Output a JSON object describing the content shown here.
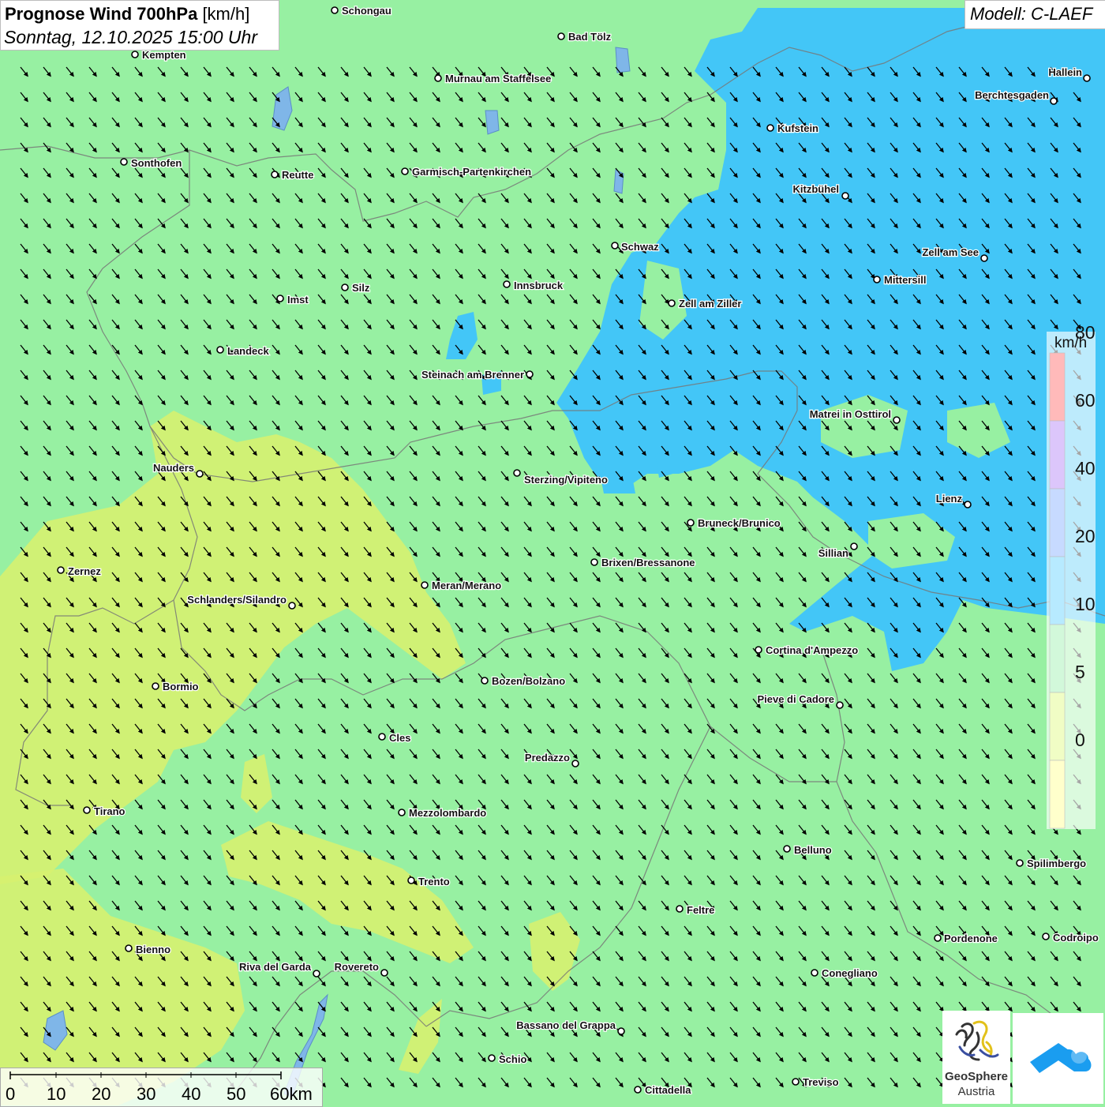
{
  "title": {
    "bold": "Prognose Wind 700hPa",
    "unit": "[km/h]",
    "datetime": "Sonntag, 12.10.2025 15:00 Uhr"
  },
  "model": "Modell: C-LAEF",
  "legend": {
    "unit": "km/h",
    "ticks": [
      "80",
      "60",
      "40",
      "20",
      "10",
      "5",
      "0"
    ],
    "colors": [
      "#ff3a3a",
      "#9b5cf2",
      "#5e95ff",
      "#33c3ff",
      "#7eea96",
      "#d4fa5a",
      "#ffff6e"
    ]
  },
  "scalebar": {
    "labels": [
      "0",
      "10",
      "20",
      "30",
      "40",
      "50",
      "60km"
    ]
  },
  "logos": {
    "geosphere_name": "GeoSphere",
    "geosphere_country": "Austria",
    "geosphere_icon": "geosphere-logo-icon",
    "app_icon": "cloud-arrow-app-icon"
  },
  "colors": {
    "background_wind": "#97f0a2",
    "strong_wind": "#43c6f7",
    "weak_wind": "#d6f170",
    "arrow": "#000000"
  },
  "wind_direction": "northwest to southeast",
  "cities": [
    {
      "name": "Schongau"
    },
    {
      "name": "Bad Tölz"
    },
    {
      "name": "Kempten"
    },
    {
      "name": "Murnau am Staffelsee"
    },
    {
      "name": "Hallein"
    },
    {
      "name": "Berchtesgaden"
    },
    {
      "name": "Kufstein"
    },
    {
      "name": "Sonthofen"
    },
    {
      "name": "Reutte"
    },
    {
      "name": "Garmisch-Partenkirchen"
    },
    {
      "name": "Kitzbühel"
    },
    {
      "name": "Schwaz"
    },
    {
      "name": "Zell am See"
    },
    {
      "name": "Mittersill"
    },
    {
      "name": "Innsbruck"
    },
    {
      "name": "Silz"
    },
    {
      "name": "Imst"
    },
    {
      "name": "Zell am Ziller"
    },
    {
      "name": "Landeck"
    },
    {
      "name": "Steinach am Brenner"
    },
    {
      "name": "Matrei in Osttirol"
    },
    {
      "name": "Nauders"
    },
    {
      "name": "Sterzing/Vipiteno"
    },
    {
      "name": "Lienz"
    },
    {
      "name": "Bruneck/Brunico"
    },
    {
      "name": "Sillian"
    },
    {
      "name": "Brixen/Bressanone"
    },
    {
      "name": "Zernez"
    },
    {
      "name": "Meran/Merano"
    },
    {
      "name": "Schlanders/Silandro"
    },
    {
      "name": "Cortina d'Ampezzo"
    },
    {
      "name": "Bozen/Bolzano"
    },
    {
      "name": "Bormio"
    },
    {
      "name": "Pieve di Cadore"
    },
    {
      "name": "Cles"
    },
    {
      "name": "Predazzo"
    },
    {
      "name": "Tirano"
    },
    {
      "name": "Mezzolombardo"
    },
    {
      "name": "Belluno"
    },
    {
      "name": "Spilimbergo"
    },
    {
      "name": "Trento"
    },
    {
      "name": "Feltre"
    },
    {
      "name": "Pordenone"
    },
    {
      "name": "Codroipo"
    },
    {
      "name": "Bienno"
    },
    {
      "name": "Riva del Garda"
    },
    {
      "name": "Rovereto"
    },
    {
      "name": "Conegliano"
    },
    {
      "name": "Bassano del Grappa"
    },
    {
      "name": "Schio"
    },
    {
      "name": "Treviso"
    },
    {
      "name": "Cittadella"
    }
  ]
}
